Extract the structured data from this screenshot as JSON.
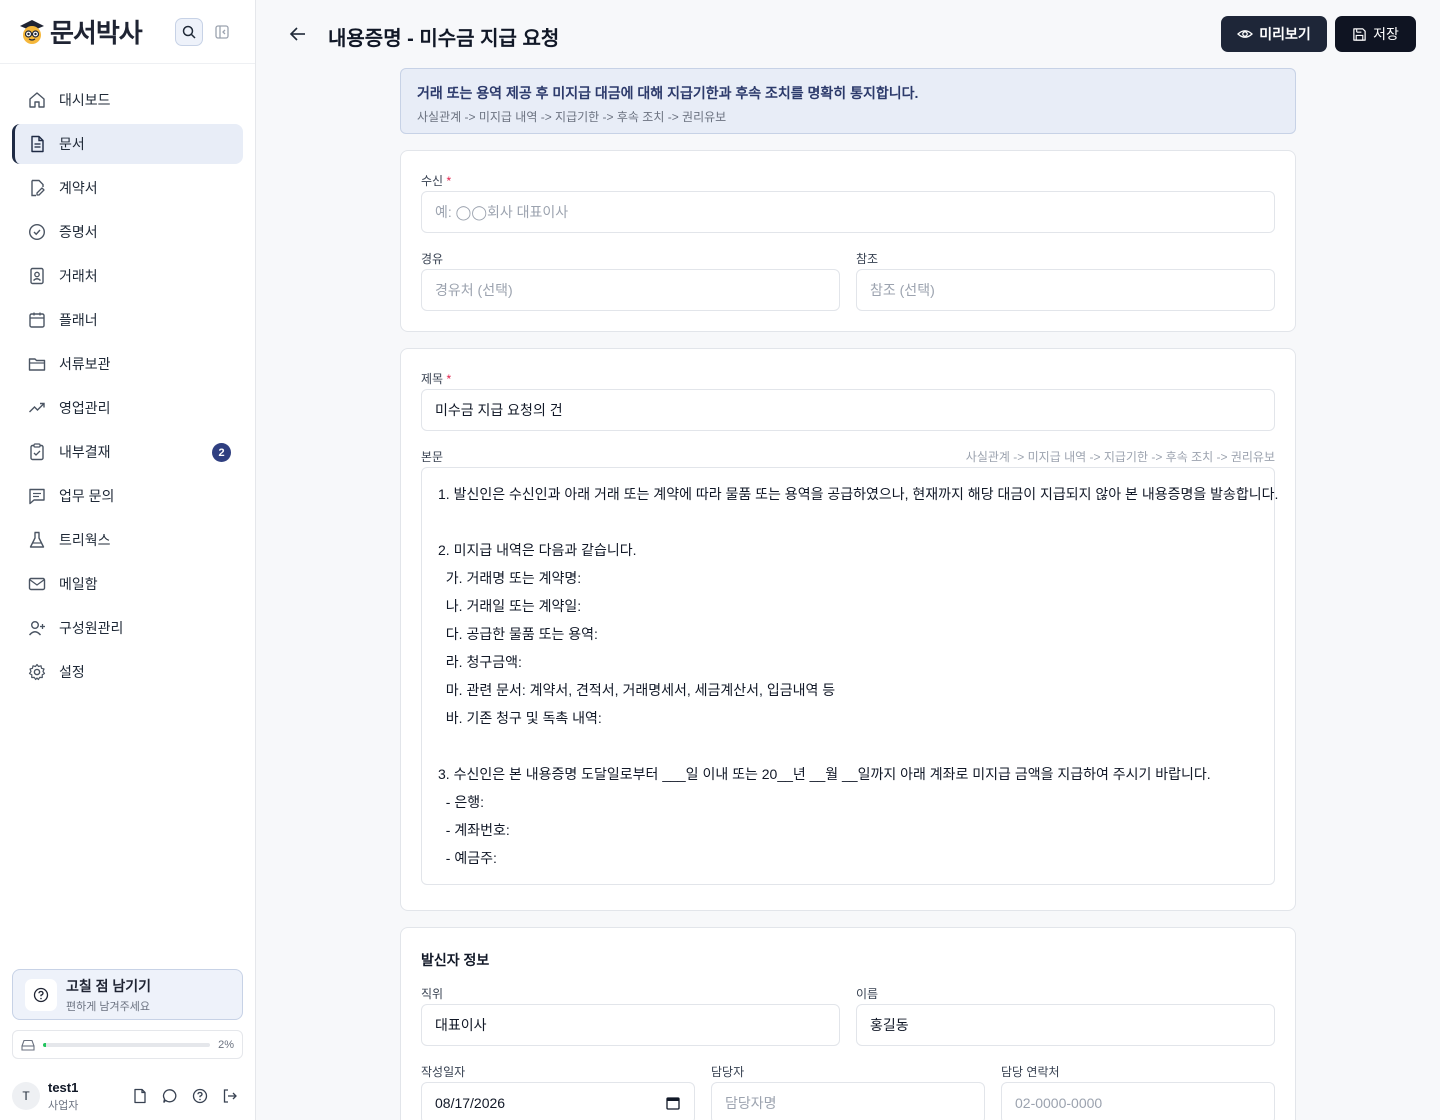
{
  "sidebar": {
    "logo": "문서박사",
    "items": [
      {
        "label": "대시보드",
        "icon": "home-icon"
      },
      {
        "label": "문서",
        "icon": "document-icon",
        "active": true
      },
      {
        "label": "계약서",
        "icon": "contract-icon"
      },
      {
        "label": "증명서",
        "icon": "badge-check-icon"
      },
      {
        "label": "거래처",
        "icon": "contact-book-icon"
      },
      {
        "label": "플래너",
        "icon": "calendar-icon"
      },
      {
        "label": "서류보관",
        "icon": "folder-icon"
      },
      {
        "label": "영업관리",
        "icon": "trend-icon"
      },
      {
        "label": "내부결재",
        "icon": "clipboard-icon",
        "badge": "2"
      },
      {
        "label": "업무 문의",
        "icon": "message-icon"
      },
      {
        "label": "트리웍스",
        "icon": "flask-icon"
      },
      {
        "label": "메일함",
        "icon": "mail-icon"
      },
      {
        "label": "구성원관리",
        "icon": "user-plus-icon"
      },
      {
        "label": "설정",
        "icon": "gear-icon"
      }
    ],
    "feedback": {
      "title": "고칠 점 남기기",
      "subtitle": "편하게 남겨주세요"
    },
    "storage": {
      "percent": 2,
      "label": "2%"
    },
    "user": {
      "initial": "T",
      "name": "test1",
      "role": "사업자"
    }
  },
  "header": {
    "title": "내용증명 - 미수금 지급 요청",
    "preview_label": "미리보기",
    "save_label": "저장"
  },
  "info": {
    "title": "거래 또는 용역 제공 후 미지급 대금에 대해 지급기한과 후속 조치를 명확히 통지합니다.",
    "flow": "사실관계 -> 미지급 내역 -> 지급기한 -> 후속 조치 -> 권리유보"
  },
  "recipient": {
    "to_label": "수신",
    "to_placeholder": "예: ◯◯회사 대표이사",
    "via_label": "경유",
    "via_placeholder": "경유처 (선택)",
    "ref_label": "참조",
    "ref_placeholder": "참조 (선택)"
  },
  "content": {
    "subject_label": "제목",
    "subject_value": "미수금 지급 요청의 건",
    "body_label": "본문",
    "body_hint": "사실관계 -> 미지급 내역 -> 지급기한 -> 후속 조치 -> 권리유보",
    "body_lines": [
      "1. 발신인은 수신인과 아래 거래 또는 계약에 따라 물품 또는 용역을 공급하였으나, 현재까지 해당 대금이 지급되지 않아 본 내용증명을 발송합니다.",
      "",
      "2. 미지급 내역은 다음과 같습니다.",
      "  가. 거래명 또는 계약명:",
      "  나. 거래일 또는 계약일:",
      "  다. 공급한 물품 또는 용역:",
      "  라. 청구금액:",
      "  마. 관련 문서: 계약서, 견적서, 거래명세서, 세금계산서, 입금내역 등",
      "  바. 기존 청구 및 독촉 내역:",
      "",
      "3. 수신인은 본 내용증명 도달일로부터 ___일 이내 또는 20__년 __월 __일까지 아래 계좌로 미지급 금액을 지급하여 주시기 바랍니다.",
      "  - 은행:",
      "  - 계좌번호:",
      "  - 예금주:"
    ]
  },
  "sender": {
    "section_title": "발신자 정보",
    "position_label": "직위",
    "position_value": "대표이사",
    "name_label": "이름",
    "name_value": "홍길동",
    "date_label": "작성일자",
    "date_value": "08/17/2026",
    "manager_label": "담당자",
    "manager_placeholder": "담당자명",
    "phone_label": "담당 연락처",
    "phone_placeholder": "02-0000-0000"
  }
}
